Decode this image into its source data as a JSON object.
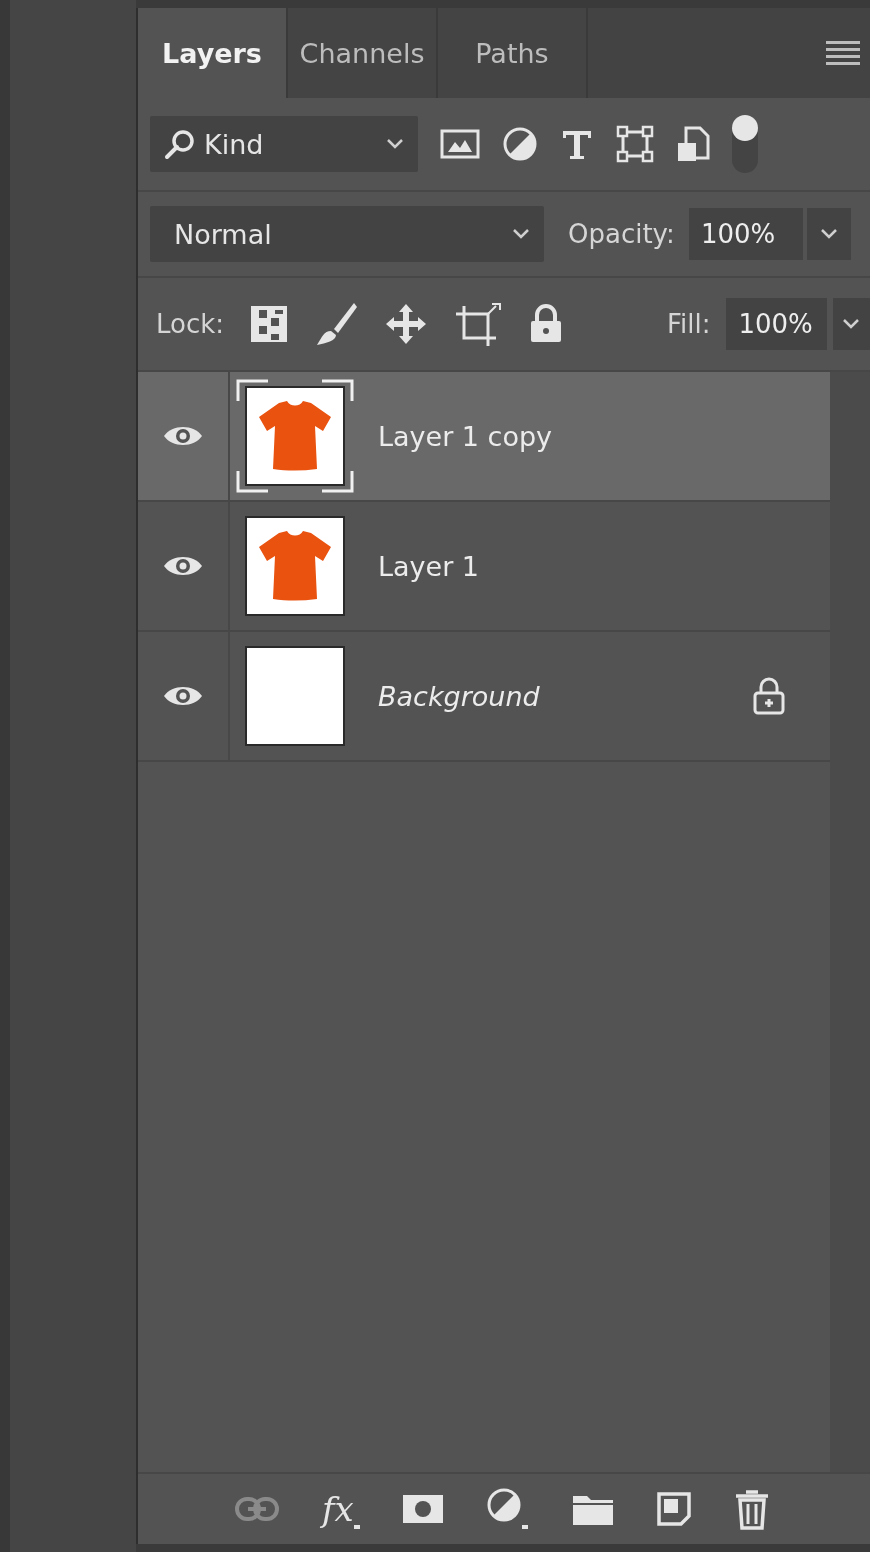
{
  "tabs": [
    {
      "label": "Layers",
      "selected": true
    },
    {
      "label": "Channels",
      "selected": false
    },
    {
      "label": "Paths",
      "selected": false
    }
  ],
  "filter": {
    "label": "Kind",
    "toggle_on": true
  },
  "blend_mode": {
    "value": "Normal"
  },
  "opacity": {
    "label": "Opacity:",
    "value": "100%"
  },
  "lock": {
    "label": "Lock:"
  },
  "fill": {
    "label": "Fill:",
    "value": "100%"
  },
  "layers": [
    {
      "name": "Layer 1 copy",
      "selected": true,
      "visible": true,
      "locked": false,
      "italic": false,
      "kind": "shirt"
    },
    {
      "name": "Layer 1",
      "selected": false,
      "visible": true,
      "locked": false,
      "italic": false,
      "kind": "shirt"
    },
    {
      "name": "Background",
      "selected": false,
      "visible": true,
      "locked": true,
      "italic": true,
      "kind": "blank"
    }
  ],
  "footer_buttons": [
    {
      "kind": "link",
      "disabled": true
    },
    {
      "kind": "fx",
      "label": "fx",
      "disabled": false
    },
    {
      "kind": "mask",
      "disabled": false
    },
    {
      "kind": "adjust",
      "disabled": false
    },
    {
      "kind": "folder",
      "disabled": false
    },
    {
      "kind": "new",
      "disabled": false
    },
    {
      "kind": "trash",
      "disabled": false
    }
  ]
}
